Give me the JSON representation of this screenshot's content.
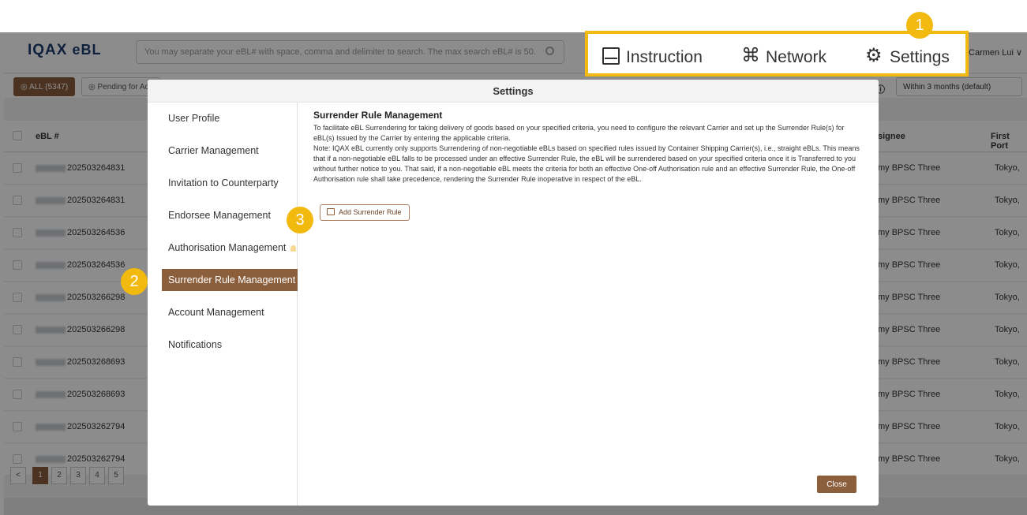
{
  "app": {
    "logo": "IQAX",
    "logo_suffix": "eBL",
    "search_placeholder": "You may separate your eBL# with space, comma and delimiter to search. The max search eBL# is 50.",
    "user": "Carmen Lui ∨",
    "tabs": [
      "◎ ALL (5347)",
      "◎ Pending for Ac"
    ],
    "filter_label": "L: ⓘ",
    "filter_value": "Within 3 months (default)",
    "columns": {
      "ebl": "eBL #",
      "consignee": "signee",
      "first_port": "First Port"
    },
    "rows": [
      {
        "ebl": "202503264831",
        "consignee": "my BPSC Three",
        "port": "Tokyo,"
      },
      {
        "ebl": "202503264831",
        "consignee": "my BPSC Three",
        "port": "Tokyo,"
      },
      {
        "ebl": "202503264536",
        "consignee": "my BPSC Three",
        "port": "Tokyo,"
      },
      {
        "ebl": "202503264536",
        "consignee": "my BPSC Three",
        "port": "Tokyo,"
      },
      {
        "ebl": "202503266298",
        "consignee": "my BPSC Three",
        "port": "Tokyo,"
      },
      {
        "ebl": "202503266298",
        "consignee": "my BPSC Three",
        "port": "Tokyo,"
      },
      {
        "ebl": "202503268693",
        "consignee": "my BPSC Three",
        "port": "Tokyo,"
      },
      {
        "ebl": "202503268693",
        "consignee": "my BPSC Three",
        "port": "Tokyo,"
      },
      {
        "ebl": "202503262794",
        "consignee": "my BPSC Three",
        "port": "Tokyo,"
      },
      {
        "ebl": "202503262794",
        "consignee": "my BPSC Three",
        "port": "Tokyo,"
      }
    ],
    "pages": [
      "1",
      "2",
      "3",
      "4",
      "5"
    ]
  },
  "modal": {
    "title": "Settings",
    "menu": [
      "User Profile",
      "Carrier Management",
      "Invitation to Counterparty",
      "Endorsee Management",
      "Authorisation Management",
      "Surrender Rule Management",
      "Account Management",
      "Notifications"
    ],
    "active_menu_index": 5,
    "section_title": "Surrender Rule Management",
    "paragraph1": "To facilitate eBL Surrendering for taking delivery of goods based on your specified criteria, you need to configure the relevant Carrier and set up the Surrender Rule(s) for eBL(s) Issued by the Carrier by entering the applicable criteria.",
    "paragraph2": "Note: IQAX eBL currently only supports Surrendering of non-negotiable eBLs based on specified rules issued by Container Shipping Carrier(s), i.e., straight eBLs. This means that if a non-negotiable eBL falls to be processed under an effective Surrender Rule, the eBL will be surrendered based on your specified criteria once it is Transferred to you without further notice to you. That said, if a non-negotiable eBL meets the criteria for both an effective One-off Authorisation rule and an effective Surrender Rule, the One-off Authorisation rule shall take precedence, rendering the Surrender Rule inoperative in respect of the eBL.",
    "add_button": "Add Surrender Rule",
    "close_button": "Close"
  },
  "callout": {
    "instruction": "Instruction",
    "network": "Network",
    "settings": "Settings"
  },
  "badges": [
    "1",
    "2",
    "3"
  ],
  "colors": {
    "accent": "#8b5e3c",
    "badge": "#f2b90f"
  }
}
